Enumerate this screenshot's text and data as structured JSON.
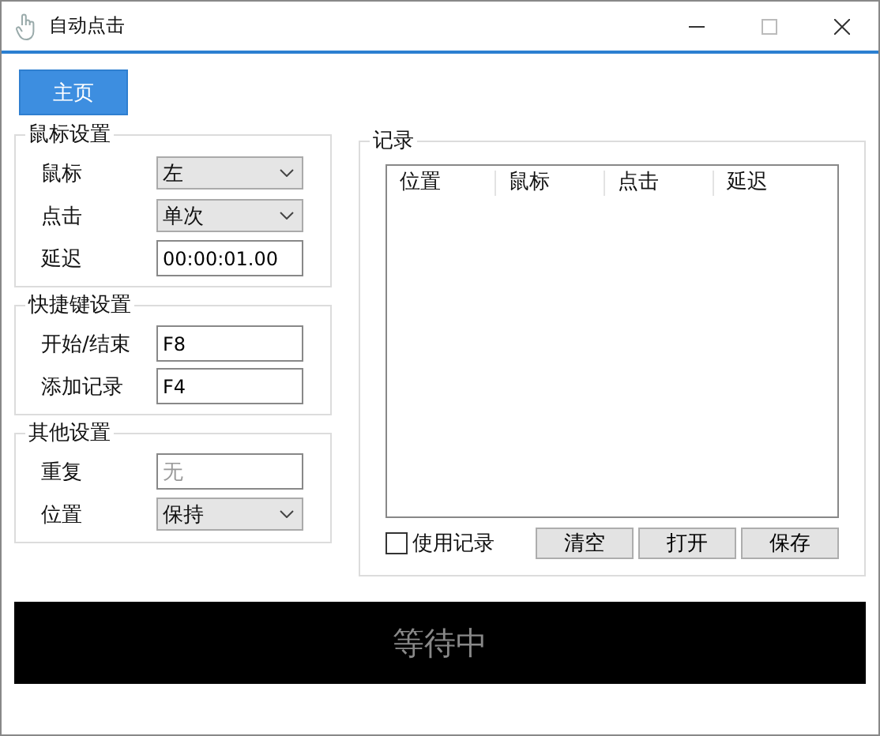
{
  "window": {
    "title": "自动点击"
  },
  "home_button": "主页",
  "mouse_settings": {
    "title": "鼠标设置",
    "fields": [
      {
        "kind": "dropdown",
        "label": "鼠标",
        "value": "左"
      },
      {
        "kind": "dropdown",
        "label": "点击",
        "value": "单次"
      },
      {
        "kind": "text",
        "label": "延迟",
        "value": "00:00:01.00"
      }
    ]
  },
  "hotkey_settings": {
    "title": "快捷键设置",
    "fields": [
      {
        "kind": "text",
        "label": "开始/结束",
        "value": "F8"
      },
      {
        "kind": "text",
        "label": "添加记录",
        "value": "F4"
      }
    ]
  },
  "other_settings": {
    "title": "其他设置",
    "fields": [
      {
        "kind": "placeholder",
        "label": "重复",
        "placeholder": "无"
      },
      {
        "kind": "dropdown",
        "label": "位置",
        "value": "保持"
      }
    ]
  },
  "records": {
    "title": "记录",
    "columns": [
      "位置",
      "鼠标",
      "点击",
      "延迟"
    ],
    "use_records": {
      "label": "使用记录",
      "checked": false
    },
    "buttons": [
      "清空",
      "打开",
      "保存"
    ]
  },
  "status": "等待中"
}
